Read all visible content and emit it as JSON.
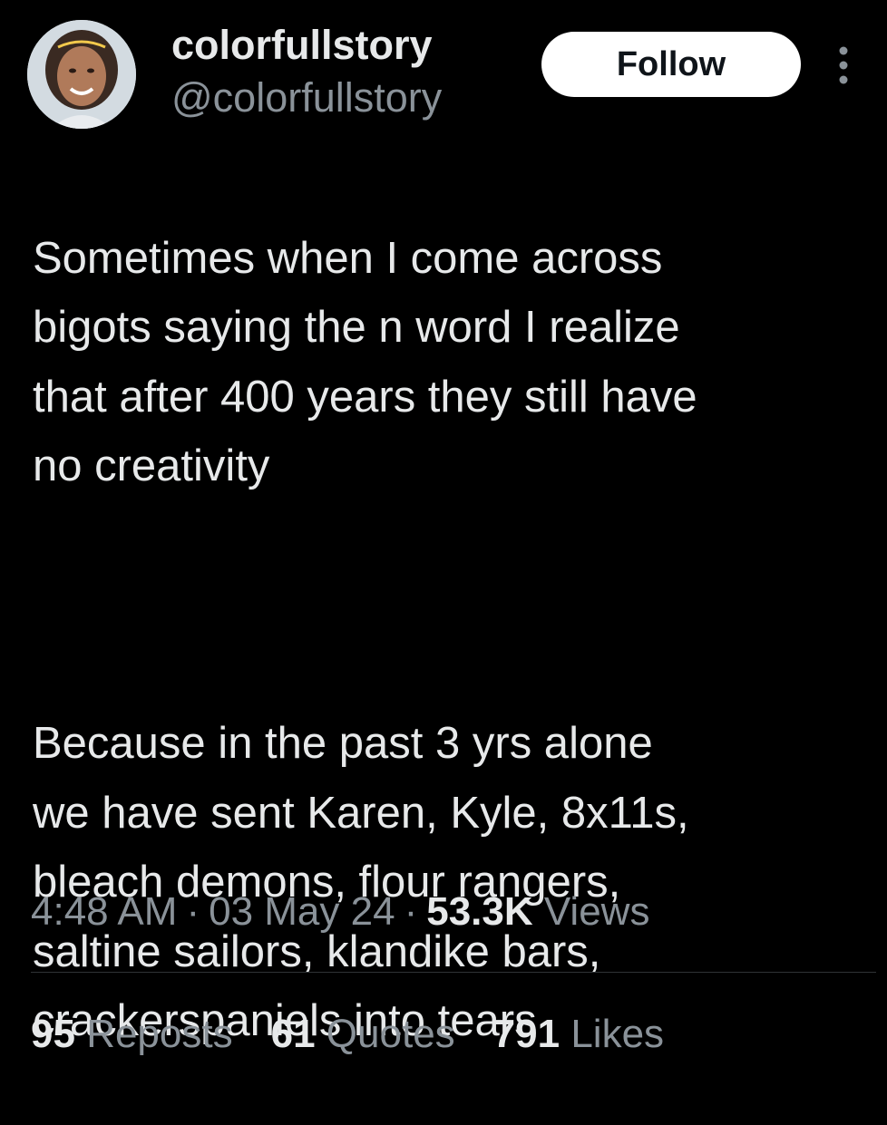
{
  "author": {
    "display_name": "colorfullstory",
    "handle": "@colorfullstory",
    "avatar": "user-avatar-photo"
  },
  "header": {
    "follow_label": "Follow",
    "more_icon": "more-dots-vertical-icon"
  },
  "tweet": {
    "paragraph_1": "Sometimes when I come across\nbigots saying the n word I realize\nthat after 400 years they still have\nno creativity",
    "paragraph_2": "Because in the past 3 yrs alone\nwe have sent Karen, Kyle, 8x11s,\nbleach demons,  flour rangers,\nsaltine sailors, klandike bars,\ncrackerspaniels into tears"
  },
  "meta": {
    "time": "4:48 AM",
    "date": "03 May 24",
    "views_count": "53.3K",
    "views_label": "Views",
    "separator": "·"
  },
  "stats": {
    "reposts_count": "95",
    "reposts_label": "Reposts",
    "quotes_count": "61",
    "quotes_label": "Quotes",
    "likes_count": "791",
    "likes_label": "Likes"
  },
  "colors": {
    "background": "#000000",
    "primary_text": "#e7e9ea",
    "secondary_text": "#8a9299",
    "follow_button_bg": "#ffffff",
    "divider": "#2f3336"
  }
}
